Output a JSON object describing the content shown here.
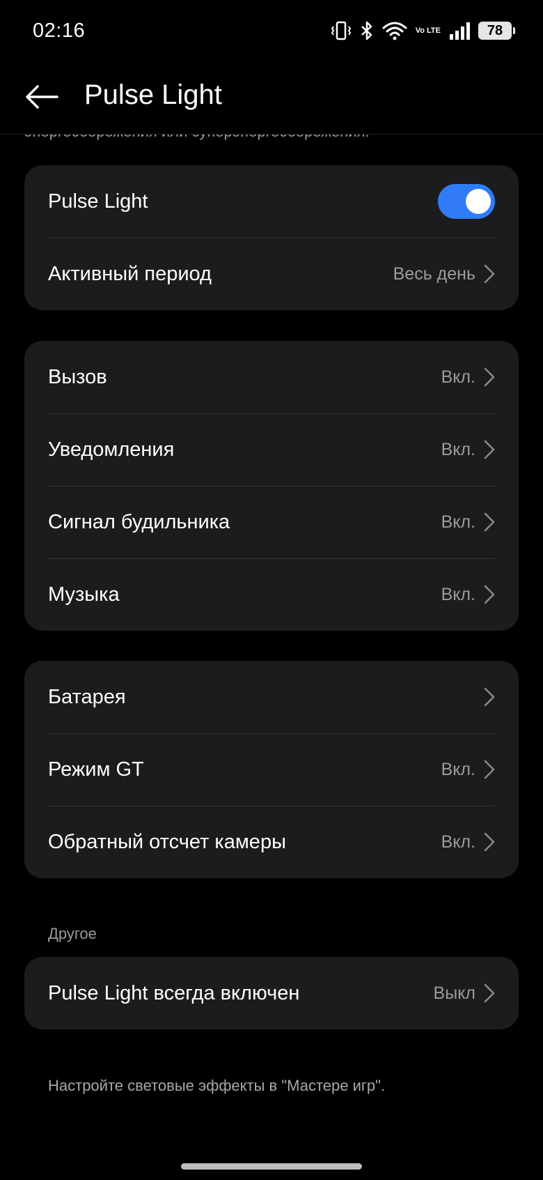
{
  "status_bar": {
    "time": "02:16",
    "network_label": "Vo LTE",
    "battery_level": "78",
    "icons": [
      "vibrate-icon",
      "bluetooth-icon",
      "wifi-icon",
      "volte-icon",
      "signal-icon",
      "battery-icon"
    ]
  },
  "header": {
    "title": "Pulse Light",
    "back_icon": "arrow-left-icon"
  },
  "clipped_description": "энергосбережения или суперэнергосбережения.",
  "main_card": {
    "toggle_label": "Pulse Light",
    "toggle_on": true,
    "active_period_label": "Активный период",
    "active_period_value": "Весь день"
  },
  "events_card": {
    "items": [
      {
        "label": "Вызов",
        "value": "Вкл."
      },
      {
        "label": "Уведомления",
        "value": "Вкл."
      },
      {
        "label": "Сигнал будильника",
        "value": "Вкл."
      },
      {
        "label": "Музыка",
        "value": "Вкл."
      }
    ]
  },
  "system_card": {
    "items": [
      {
        "label": "Батарея",
        "value": ""
      },
      {
        "label": "Режим GT",
        "value": "Вкл."
      },
      {
        "label": "Обратный отсчет камеры",
        "value": "Вкл."
      }
    ]
  },
  "other_section": {
    "label": "Другое",
    "item_label": "Pulse Light всегда включен",
    "item_value": "Выкл"
  },
  "footer_note": "Настройте световые эффекты в \"Мастере игр\".",
  "colors": {
    "background": "#000000",
    "card": "#1c1c1e",
    "accent": "#2f7cf6",
    "secondary_text": "#9b9b9b"
  }
}
